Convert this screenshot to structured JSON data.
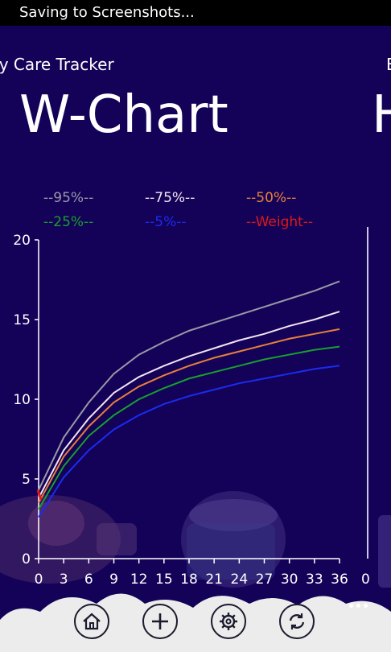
{
  "status_bar": {
    "text": "Saving to Screenshots..."
  },
  "header": {
    "app_title": "by Care Tracker",
    "page_title": "W-Chart",
    "next_app_title": "B",
    "next_page_title": "H"
  },
  "legend": [
    {
      "label": "--95%--",
      "color": "#9a9aa6"
    },
    {
      "label": "--75%--",
      "color": "#f4e4f0"
    },
    {
      "label": "--50%--",
      "color": "#e8803a"
    },
    {
      "label": "--25%--",
      "color": "#17a02e"
    },
    {
      "label": "--5%--",
      "color": "#1a2cf0"
    },
    {
      "label": "--Weight--",
      "color": "#e01818"
    }
  ],
  "chart_data": {
    "type": "line",
    "x": [
      0,
      3,
      6,
      9,
      12,
      15,
      18,
      21,
      24,
      27,
      30,
      33,
      36
    ],
    "xlim": [
      0,
      36
    ],
    "ylim": [
      0,
      20
    ],
    "xticks": [
      "0",
      "3",
      "6",
      "9",
      "12",
      "15",
      "18",
      "21",
      "24",
      "27",
      "30",
      "33",
      "36"
    ],
    "yticks": [
      "0",
      "5",
      "10",
      "15",
      "20"
    ],
    "grid": false,
    "legend_position": "top",
    "series": [
      {
        "name": "--95%--",
        "color": "#9a9aa6",
        "values": [
          4.3,
          7.6,
          9.8,
          11.6,
          12.8,
          13.6,
          14.3,
          14.8,
          15.3,
          15.8,
          16.3,
          16.8,
          17.4
        ]
      },
      {
        "name": "--75%--",
        "color": "#f4e4f0",
        "values": [
          3.8,
          6.8,
          8.8,
          10.4,
          11.4,
          12.1,
          12.7,
          13.2,
          13.7,
          14.1,
          14.6,
          15.0,
          15.5
        ]
      },
      {
        "name": "--50%--",
        "color": "#e8803a",
        "values": [
          3.5,
          6.4,
          8.3,
          9.8,
          10.8,
          11.5,
          12.1,
          12.6,
          13.0,
          13.4,
          13.8,
          14.1,
          14.4
        ]
      },
      {
        "name": "--25%--",
        "color": "#17a02e",
        "values": [
          3.1,
          5.8,
          7.7,
          9.0,
          10.0,
          10.7,
          11.3,
          11.7,
          12.1,
          12.5,
          12.8,
          13.1,
          13.3
        ]
      },
      {
        "name": "--5%--",
        "color": "#1a2cf0",
        "values": [
          2.6,
          5.1,
          6.8,
          8.1,
          9.0,
          9.7,
          10.2,
          10.6,
          11.0,
          11.3,
          11.6,
          11.9,
          12.1
        ]
      },
      {
        "name": "--Weight--",
        "color": "#e01818",
        "values": [
          4.0
        ]
      }
    ]
  },
  "next_pivot": {
    "tick": "0"
  },
  "appbar": {
    "buttons": [
      {
        "name": "home",
        "icon": "home-icon"
      },
      {
        "name": "add",
        "icon": "plus-icon"
      },
      {
        "name": "settings",
        "icon": "gear-icon"
      },
      {
        "name": "sync",
        "icon": "refresh-icon"
      }
    ],
    "more": "more-icon"
  }
}
